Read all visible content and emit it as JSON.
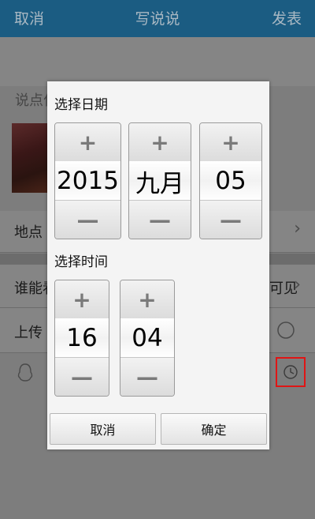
{
  "header": {
    "cancel_label": "取消",
    "title": "写说说",
    "post_label": "发表"
  },
  "post": {
    "placeholder": "说点什么吧..."
  },
  "rows": {
    "location_label": "地点",
    "visibility_label": "谁能看",
    "visibility_value": "可见",
    "upload_label": "上传"
  },
  "dialog": {
    "date_title": "选择日期",
    "time_title": "选择时间",
    "year": "2015",
    "month": "九月",
    "day": "05",
    "hour": "16",
    "minute": "04",
    "plus_symbol": "+",
    "minus_symbol": "—",
    "cancel_label": "取消",
    "ok_label": "确定"
  },
  "colors": {
    "header_bg": "#1b5c82",
    "highlight_border": "#e01515"
  },
  "icons": [
    "chevron-right-icon",
    "qq-penguin-icon",
    "clock-icon",
    "radio-icon"
  ]
}
